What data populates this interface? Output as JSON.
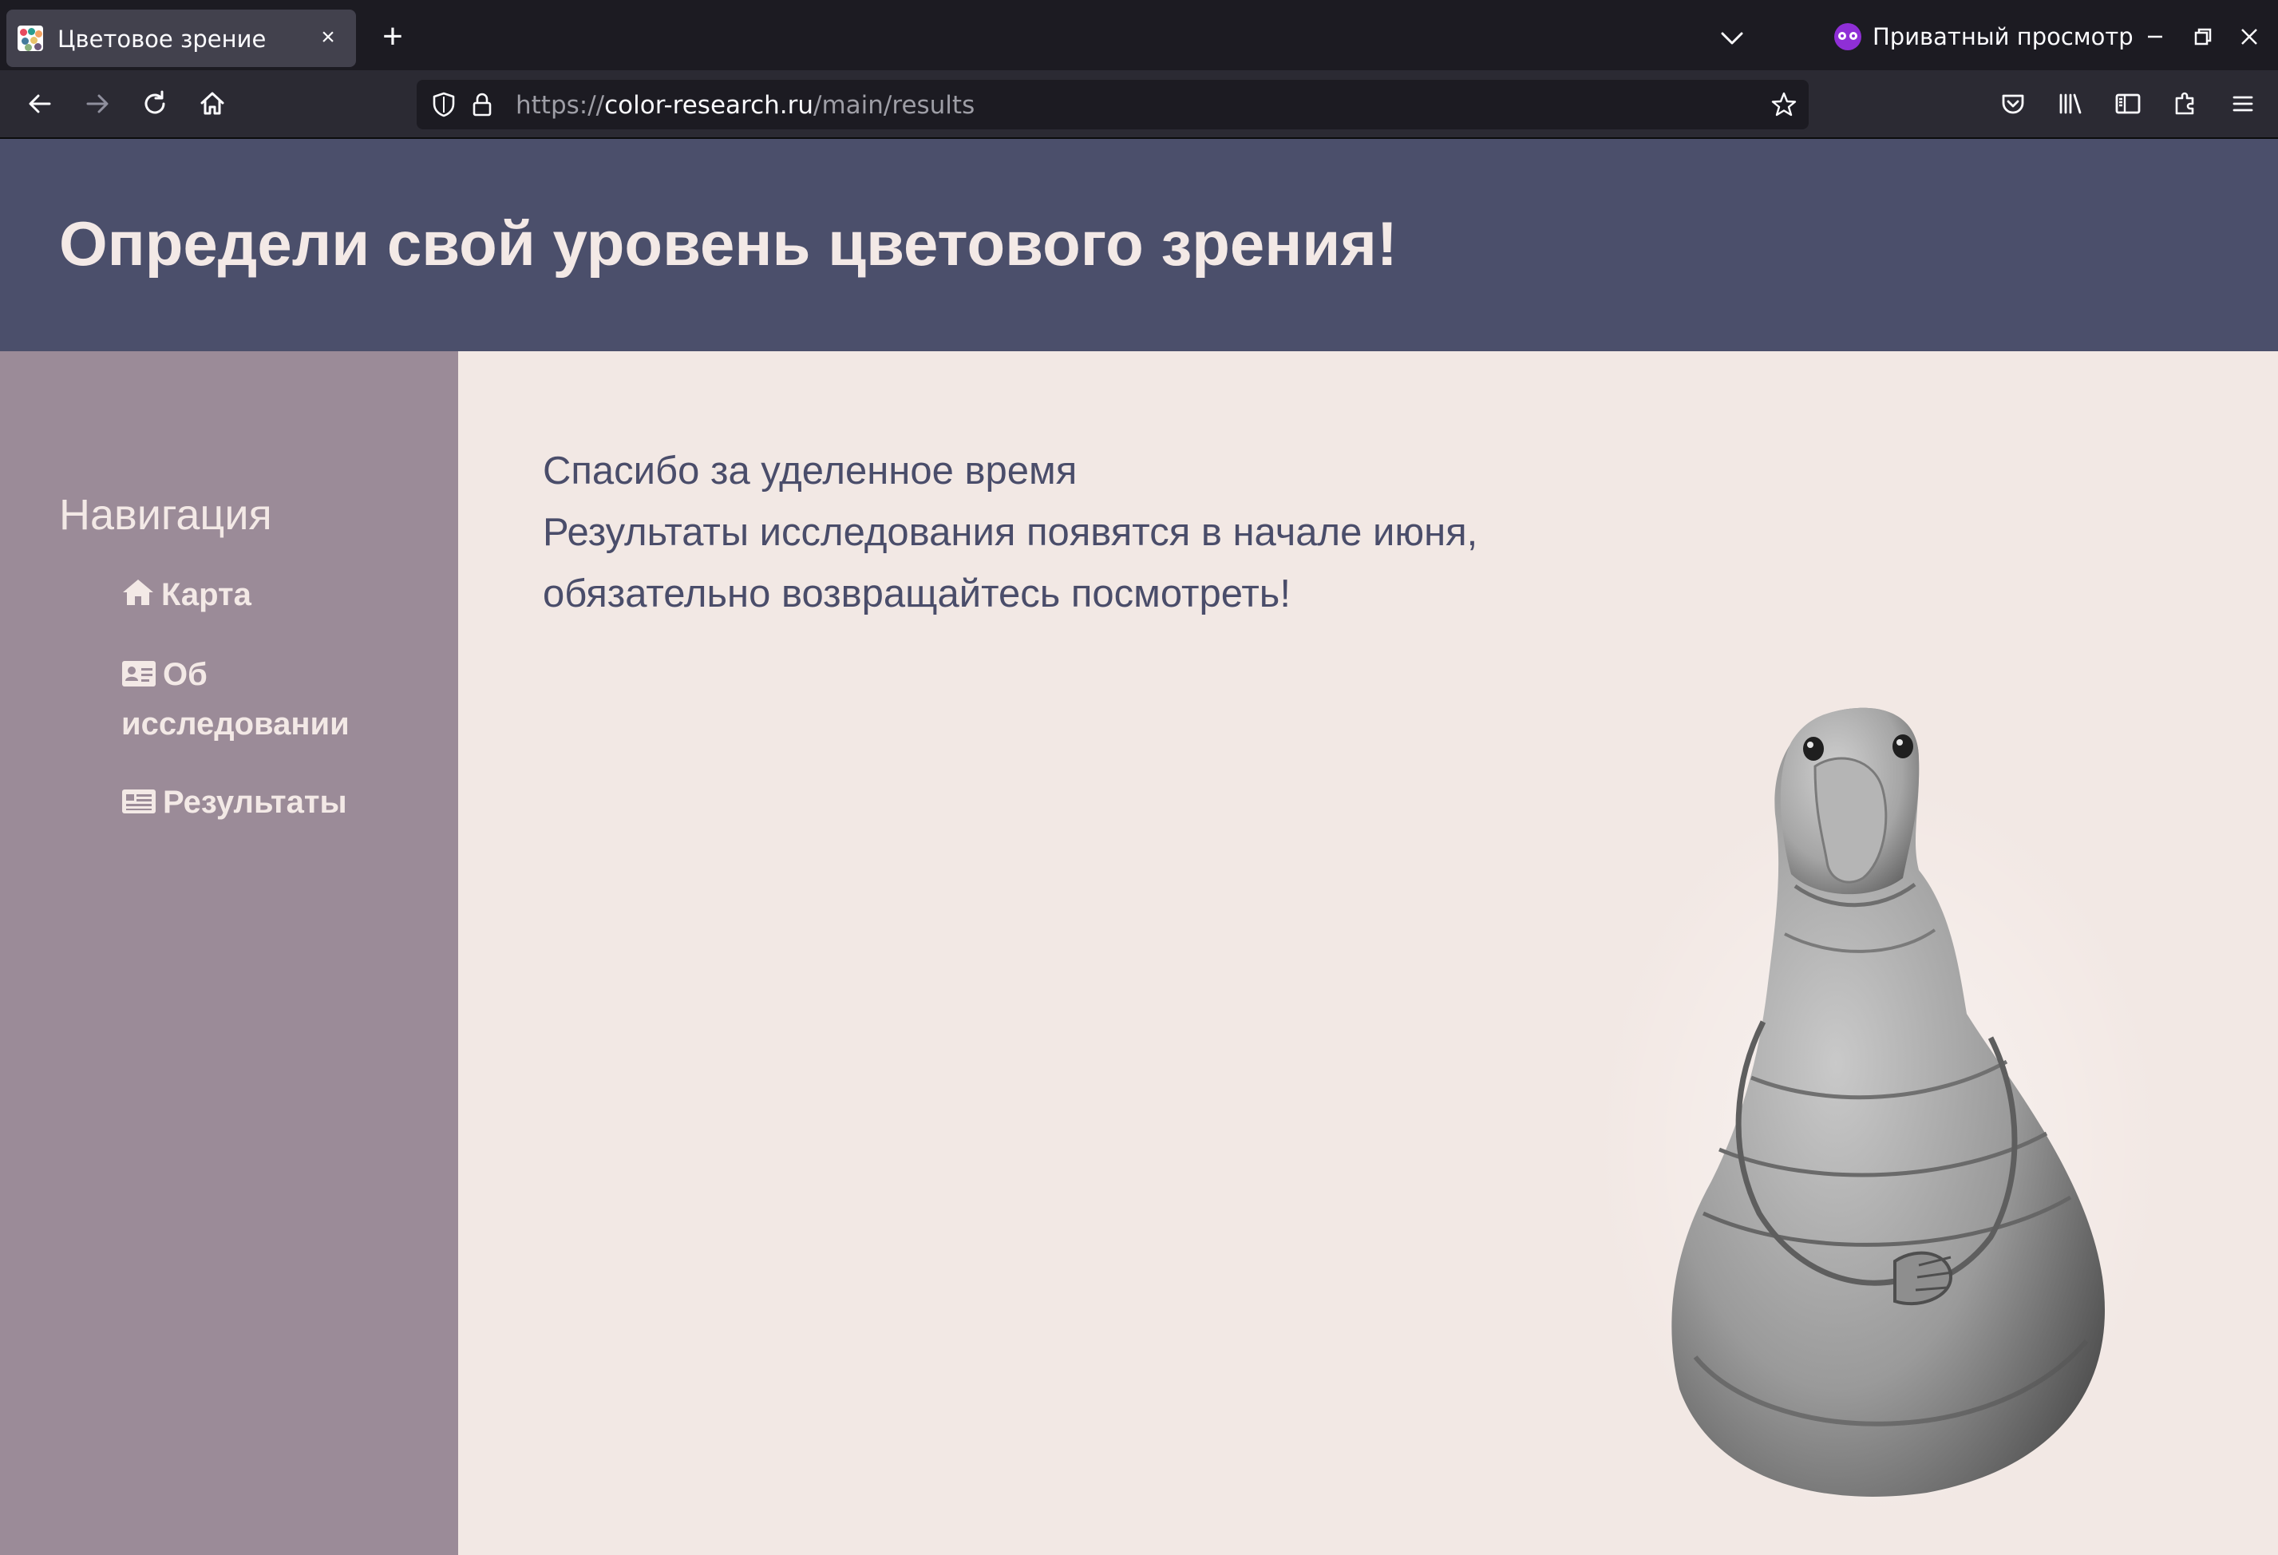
{
  "browser": {
    "tab_title": "Цветовое зрение",
    "private_label": "Приватный просмотр",
    "url": {
      "scheme": "https://",
      "host": "color-research.ru",
      "path": "/main/results"
    }
  },
  "page": {
    "title": "Определи свой уровень цветового зрения!",
    "nav": {
      "heading": "Навигация",
      "items": [
        {
          "label": "Карта",
          "icon": "home-icon"
        },
        {
          "label": "Об исследовании",
          "icon": "id-card-icon"
        },
        {
          "label": "Результаты",
          "icon": "newspaper-icon"
        }
      ]
    },
    "message": {
      "line1": "Спасибо за уделенное время",
      "line2": "Результаты исследования появятся в начале июня,",
      "line3": "обязательно возвращайтесь посмотреть!"
    },
    "image": {
      "subject": "grey-creature-figure"
    }
  },
  "colors": {
    "header_bg": "#4b4f6b",
    "sidebar_bg": "#9b8b98",
    "content_bg": "#f2e8e4",
    "text_light": "#f3e9e6",
    "text_dark": "#4a4d6a"
  }
}
